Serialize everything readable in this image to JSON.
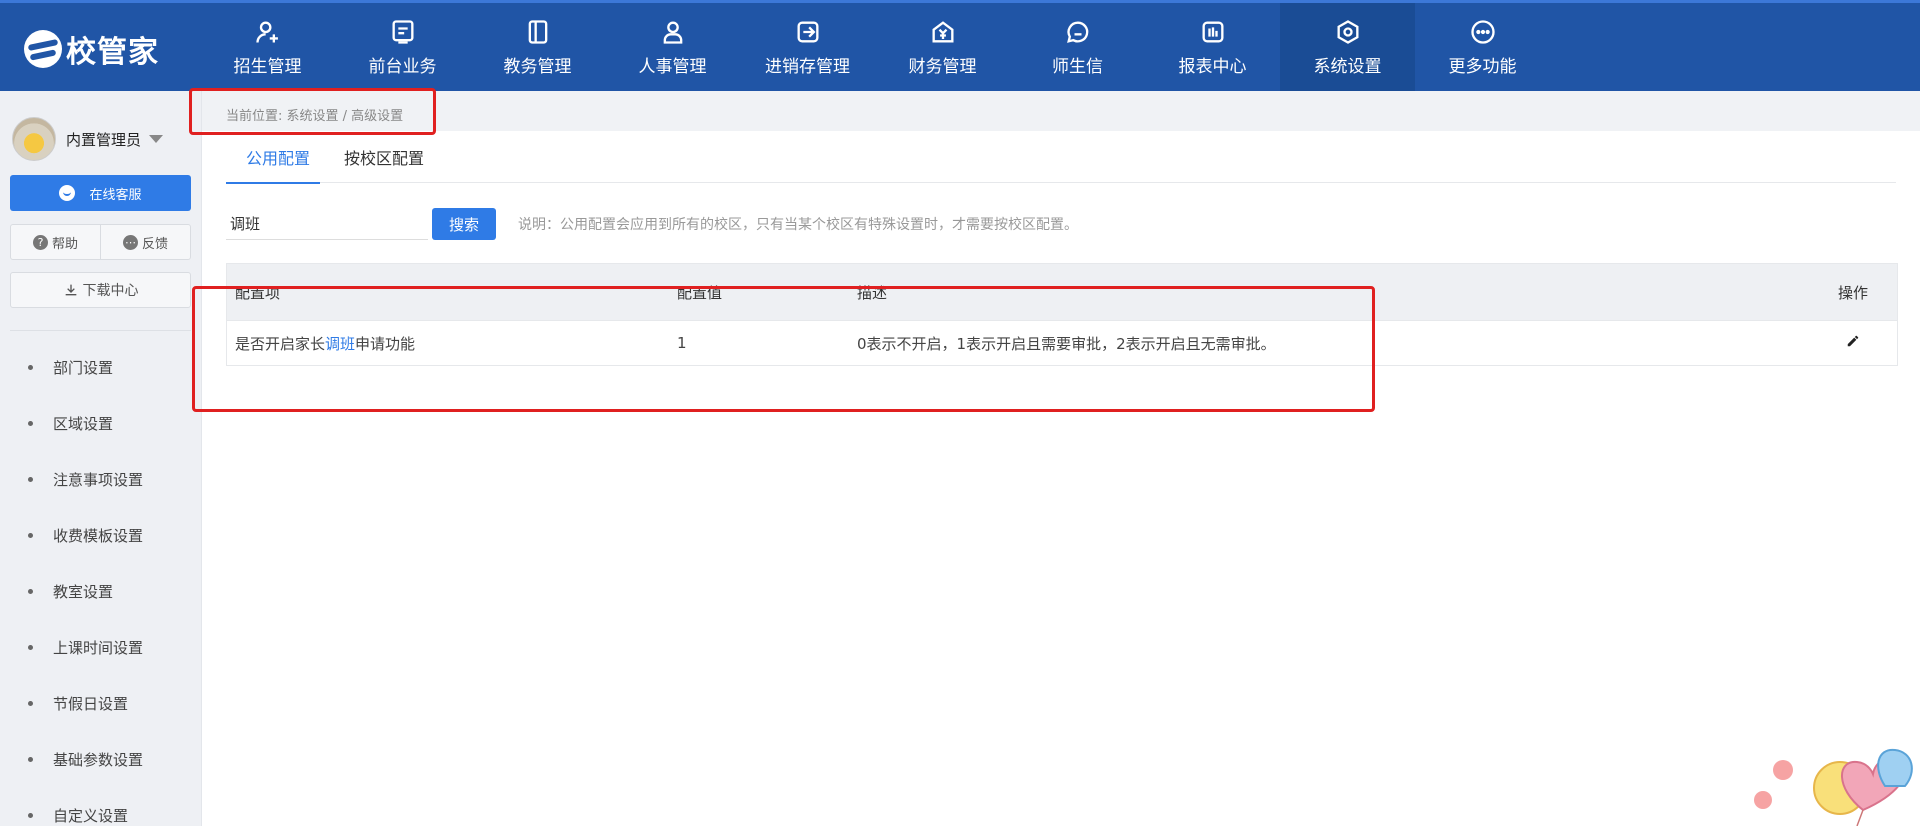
{
  "brand": {
    "name": "校管家"
  },
  "nav": [
    {
      "label": "招生管理",
      "icon": "add-user-icon"
    },
    {
      "label": "前台业务",
      "icon": "monitor-icon"
    },
    {
      "label": "教务管理",
      "icon": "book-icon"
    },
    {
      "label": "人事管理",
      "icon": "person-icon"
    },
    {
      "label": "进销存管理",
      "icon": "arrow-box-icon"
    },
    {
      "label": "财务管理",
      "icon": "yen-house-icon"
    },
    {
      "label": "师生信",
      "icon": "chat-icon"
    },
    {
      "label": "报表中心",
      "icon": "bar-report-icon"
    },
    {
      "label": "系统设置",
      "icon": "gear-hex-icon",
      "active": true
    },
    {
      "label": "更多功能",
      "icon": "more-dots-icon"
    }
  ],
  "user": {
    "name": "内置管理员"
  },
  "sidebar": {
    "service_label": "在线客服",
    "help_label": "帮助",
    "feedback_label": "反馈",
    "download_label": "下载中心",
    "menu": [
      "部门设置",
      "区域设置",
      "注意事项设置",
      "收费模板设置",
      "教室设置",
      "上课时间设置",
      "节假日设置",
      "基础参数设置",
      "自定义设置"
    ]
  },
  "breadcrumb": "当前位置: 系统设置 / 高级设置",
  "tabs": [
    "公用配置",
    "按校区配置"
  ],
  "search": {
    "value": "调班",
    "button_label": "搜索",
    "note": "说明：公用配置会应用到所有的校区，只有当某个校区有特殊设置时，才需要按校区配置。"
  },
  "table": {
    "headers": [
      "配置项",
      "配置值",
      "描述",
      "操作"
    ],
    "rows": [
      {
        "name_prefix": "是否开启家长",
        "name_keyword": "调班",
        "name_suffix": "申请功能",
        "value": "1",
        "description": "0表示不开启，1表示开启且需要审批，2表示开启且无需审批。"
      }
    ]
  },
  "colors": {
    "topbar": "#2055a6",
    "accent": "#2f7be6",
    "highlight": "#e02020"
  }
}
